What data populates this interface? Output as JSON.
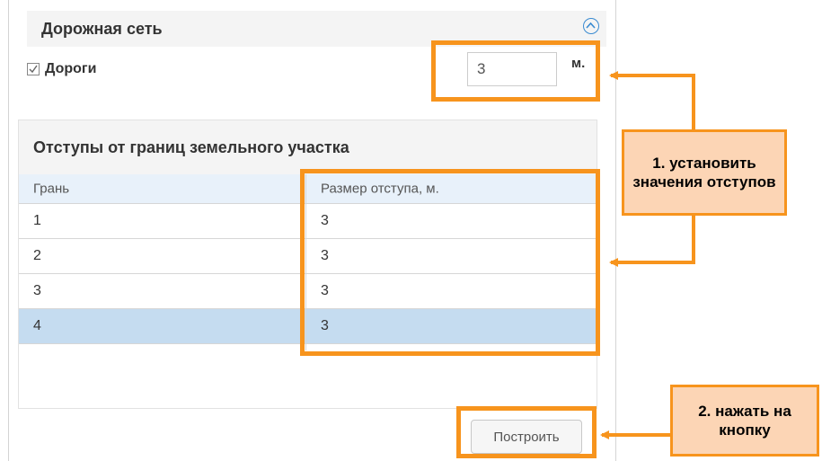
{
  "road_network": {
    "title": "Дорожная сеть",
    "roads_label": "Дороги",
    "roads_checked": true,
    "roads_value": "3",
    "unit": "м."
  },
  "setbacks": {
    "title": "Отступы от границ земельного участка",
    "columns": [
      "Грань",
      "Размер отступа, м."
    ],
    "rows": [
      {
        "edge": "1",
        "size": "3",
        "selected": false
      },
      {
        "edge": "2",
        "size": "3",
        "selected": false
      },
      {
        "edge": "3",
        "size": "3",
        "selected": false
      },
      {
        "edge": "4",
        "size": "3",
        "selected": true
      }
    ]
  },
  "build_button": "Построить",
  "annotations": {
    "step1": "1. установить значения отступов",
    "step2": "2. нажать на кнопку"
  },
  "colors": {
    "highlight": "#f7941d",
    "callout_fill": "#fcd5b5",
    "selected_row": "#c5dcf0",
    "accent_blue": "#3a8bd1"
  }
}
